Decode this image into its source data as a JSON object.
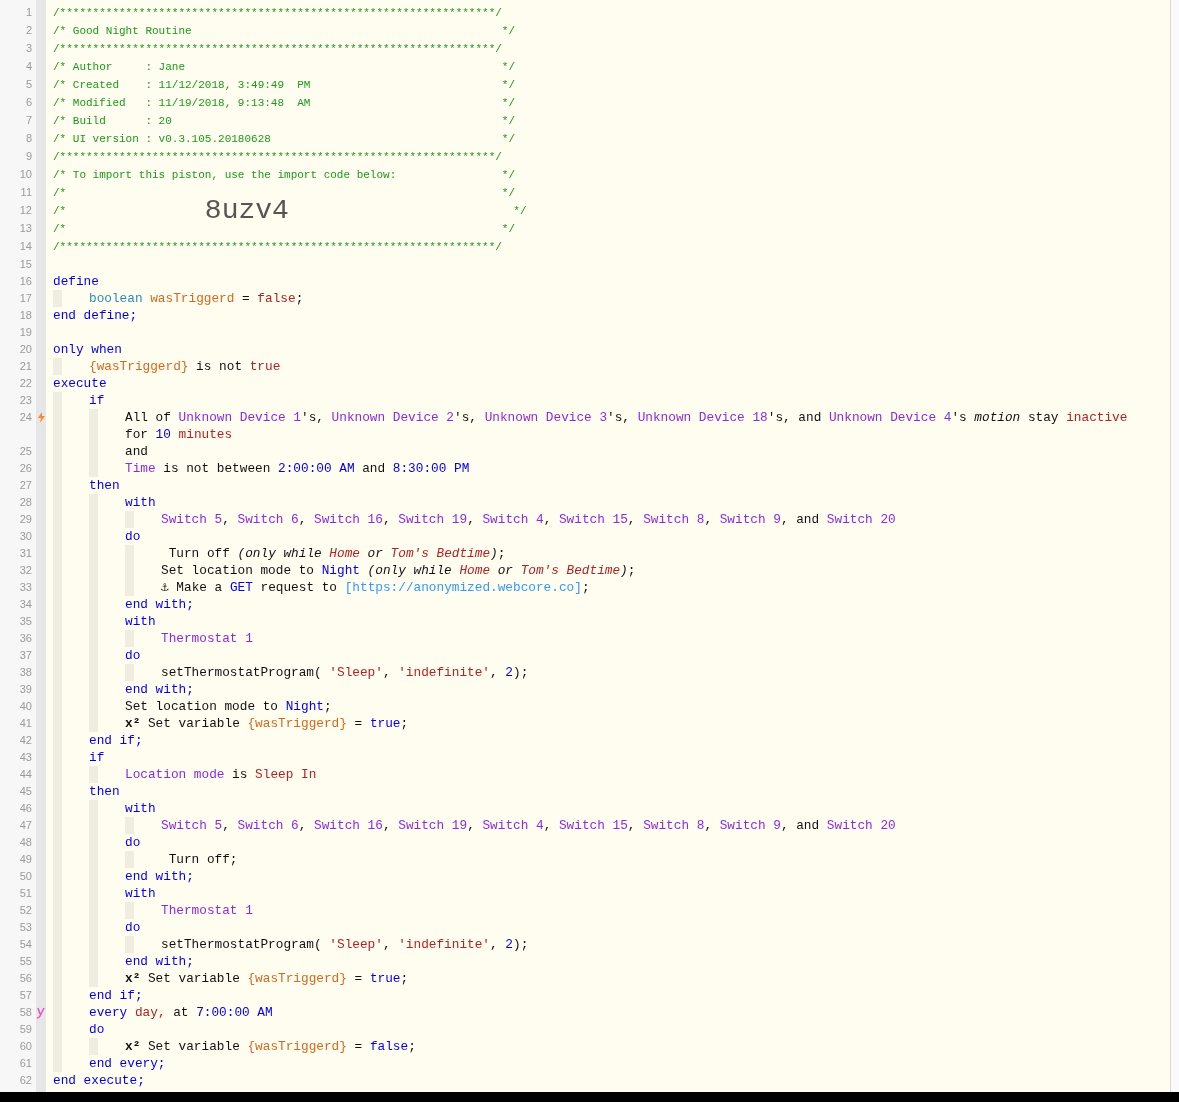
{
  "lines": [
    {
      "number": "1",
      "segments": [
        {
          "kind": "comment",
          "text": "/******************************************************************/"
        }
      ]
    },
    {
      "number": "2",
      "segments": [
        {
          "kind": "comment",
          "text": "/* Good Night Routine                                               */"
        }
      ]
    },
    {
      "number": "3",
      "segments": [
        {
          "kind": "comment",
          "text": "/******************************************************************/"
        }
      ]
    },
    {
      "number": "4",
      "segments": [
        {
          "kind": "comment",
          "text": "/* Author     : Jane                                                */"
        }
      ]
    },
    {
      "number": "5",
      "segments": [
        {
          "kind": "comment",
          "text": "/* Created    : 11/12/2018, 3:49:49  PM                             */"
        }
      ]
    },
    {
      "number": "6",
      "segments": [
        {
          "kind": "comment",
          "text": "/* Modified   : 11/19/2018, 9:13:48  AM                             */"
        }
      ]
    },
    {
      "number": "7",
      "segments": [
        {
          "kind": "comment",
          "text": "/* Build      : 20                                                  */"
        }
      ]
    },
    {
      "number": "8",
      "segments": [
        {
          "kind": "comment",
          "text": "/* UI version : v0.3.105.20180628                                   */"
        }
      ]
    },
    {
      "number": "9",
      "segments": [
        {
          "kind": "comment",
          "text": "/******************************************************************/"
        }
      ]
    },
    {
      "number": "10",
      "segments": [
        {
          "kind": "comment",
          "text": "/* To import this piston, use the import code below:                */"
        }
      ]
    },
    {
      "number": "11",
      "segments": [
        {
          "kind": "comment",
          "text": "/*                                                                  */"
        }
      ]
    },
    {
      "number": "12",
      "segments": [
        {
          "kind": "comment",
          "text": "/*                     "
        },
        {
          "kind": "import-code",
          "text": "8uzv4"
        },
        {
          "kind": "comment",
          "text": "                                  */"
        }
      ]
    },
    {
      "number": "13",
      "segments": [
        {
          "kind": "comment",
          "text": "/*                                                                  */"
        }
      ]
    },
    {
      "number": "14",
      "segments": [
        {
          "kind": "comment",
          "text": "/******************************************************************/"
        }
      ]
    },
    {
      "number": "15"
    },
    {
      "number": "16",
      "segments": [
        {
          "kind": "keyword",
          "text": "define"
        }
      ],
      "children": [
        {
          "number": "17",
          "segments": [
            {
              "kind": "type",
              "text": "boolean "
            },
            {
              "kind": "variable",
              "text": "wasTriggerd"
            },
            {
              "kind": "plain",
              "text": " = "
            },
            {
              "kind": "value",
              "text": "false"
            },
            {
              "kind": "plain",
              "text": ";"
            }
          ]
        }
      ]
    },
    {
      "number": "18",
      "segments": [
        {
          "kind": "keyword",
          "text": "end define;"
        }
      ]
    },
    {
      "number": "19"
    },
    {
      "number": "20",
      "segments": [
        {
          "kind": "keyword",
          "text": "only when"
        }
      ],
      "children": [
        {
          "number": "21",
          "segments": [
            {
              "kind": "variable",
              "text": "{wasTriggerd}"
            },
            {
              "kind": "plain",
              "text": " is not "
            },
            {
              "kind": "value",
              "text": "true"
            }
          ]
        }
      ]
    },
    {
      "number": "22",
      "segments": [
        {
          "kind": "keyword",
          "text": "execute"
        }
      ],
      "children": [
        {
          "number": "23",
          "segments": [
            {
              "kind": "keyword",
              "text": "if"
            }
          ],
          "children": [
            {
              "number": "24",
              "kind": "trigger",
              "segments": [
                {
                  "kind": "plain",
                  "text": "All of "
                },
                {
                  "kind": "device",
                  "text": "Unknown Device 1"
                },
                {
                  "kind": "plain",
                  "text": "'s, "
                },
                {
                  "kind": "device",
                  "text": "Unknown Device 2"
                },
                {
                  "kind": "plain",
                  "text": "'s, "
                },
                {
                  "kind": "device",
                  "text": "Unknown Device 3"
                },
                {
                  "kind": "plain",
                  "text": "'s, "
                },
                {
                  "kind": "device",
                  "text": "Unknown Device 18"
                },
                {
                  "kind": "plain",
                  "text": "'s, and "
                },
                {
                  "kind": "device",
                  "text": "Unknown Device 4"
                },
                {
                  "kind": "plain",
                  "text": "'s "
                },
                {
                  "kind": "italic",
                  "text": "motion"
                },
                {
                  "kind": "plain",
                  "text": " stay "
                },
                {
                  "kind": "value",
                  "text": "inactive"
                },
                {
                  "kind": "plain",
                  "text": " for "
                },
                {
                  "kind": "keyword",
                  "text": "10"
                },
                {
                  "kind": "value",
                  "text": " minutes"
                }
              ]
            },
            {
              "number": "25",
              "segments": [
                {
                  "kind": "plain",
                  "text": "and"
                }
              ]
            },
            {
              "number": "26",
              "segments": [
                {
                  "kind": "device",
                  "text": "Time"
                },
                {
                  "kind": "plain",
                  "text": " is not between "
                },
                {
                  "kind": "keyword",
                  "text": "2:00:00 AM"
                },
                {
                  "kind": "plain",
                  "text": " and "
                },
                {
                  "kind": "keyword",
                  "text": "8:30:00 PM"
                }
              ]
            }
          ]
        },
        {
          "number": "27",
          "segments": [
            {
              "kind": "keyword",
              "text": "then"
            }
          ],
          "children": [
            {
              "number": "28",
              "segments": [
                {
                  "kind": "keyword",
                  "text": "with"
                }
              ],
              "children": [
                {
                  "number": "29",
                  "segments": [
                    {
                      "kind": "device",
                      "text": "Switch 5"
                    },
                    {
                      "kind": "plain",
                      "text": ", "
                    },
                    {
                      "kind": "device",
                      "text": "Switch 6"
                    },
                    {
                      "kind": "plain",
                      "text": ", "
                    },
                    {
                      "kind": "device",
                      "text": "Switch 16"
                    },
                    {
                      "kind": "plain",
                      "text": ", "
                    },
                    {
                      "kind": "device",
                      "text": "Switch 19"
                    },
                    {
                      "kind": "plain",
                      "text": ", "
                    },
                    {
                      "kind": "device",
                      "text": "Switch 4"
                    },
                    {
                      "kind": "plain",
                      "text": ", "
                    },
                    {
                      "kind": "device",
                      "text": "Switch 15"
                    },
                    {
                      "kind": "plain",
                      "text": ", "
                    },
                    {
                      "kind": "device",
                      "text": "Switch 8"
                    },
                    {
                      "kind": "plain",
                      "text": ", "
                    },
                    {
                      "kind": "device",
                      "text": "Switch 9"
                    },
                    {
                      "kind": "plain",
                      "text": ", and "
                    },
                    {
                      "kind": "device",
                      "text": "Switch 20"
                    }
                  ]
                }
              ]
            },
            {
              "number": "30",
              "segments": [
                {
                  "kind": "keyword",
                  "text": "do"
                }
              ],
              "children": [
                {
                  "number": "31",
                  "segments": [
                    {
                      "kind": "plain",
                      "text": " Turn off "
                    },
                    {
                      "kind": "italic",
                      "text": "(only while "
                    },
                    {
                      "kind": "italic-value",
                      "text": "Home"
                    },
                    {
                      "kind": "italic",
                      "text": " or "
                    },
                    {
                      "kind": "italic-value",
                      "text": "Tom's Bedtime"
                    },
                    {
                      "kind": "italic",
                      "text": ")"
                    },
                    {
                      "kind": "plain",
                      "text": ";"
                    }
                  ]
                },
                {
                  "number": "32",
                  "segments": [
                    {
                      "kind": "plain",
                      "text": "Set location mode to "
                    },
                    {
                      "kind": "keyword",
                      "text": "Night"
                    },
                    {
                      "kind": "italic",
                      "text": " (only while "
                    },
                    {
                      "kind": "italic-value",
                      "text": "Home"
                    },
                    {
                      "kind": "italic",
                      "text": " or "
                    },
                    {
                      "kind": "italic-value",
                      "text": "Tom's Bedtime"
                    },
                    {
                      "kind": "italic",
                      "text": ")"
                    },
                    {
                      "kind": "plain",
                      "text": ";"
                    }
                  ]
                },
                {
                  "number": "33",
                  "segments": [
                    {
                      "kind": "plain",
                      "text": "⚓ Make a "
                    },
                    {
                      "kind": "keyword",
                      "text": "GET"
                    },
                    {
                      "kind": "plain",
                      "text": " request to "
                    },
                    {
                      "kind": "url",
                      "text": "[https://anonymized.webcore.co]"
                    },
                    {
                      "kind": "plain",
                      "text": ";"
                    }
                  ]
                }
              ]
            },
            {
              "number": "34",
              "segments": [
                {
                  "kind": "keyword",
                  "text": "end with;"
                }
              ]
            },
            {
              "number": "35",
              "segments": [
                {
                  "kind": "keyword",
                  "text": "with"
                }
              ],
              "children": [
                {
                  "number": "36",
                  "segments": [
                    {
                      "kind": "device",
                      "text": "Thermostat 1"
                    }
                  ]
                }
              ]
            },
            {
              "number": "37",
              "segments": [
                {
                  "kind": "keyword",
                  "text": "do"
                }
              ],
              "children": [
                {
                  "number": "38",
                  "segments": [
                    {
                      "kind": "plain",
                      "text": "setThermostatProgram( "
                    },
                    {
                      "kind": "value",
                      "text": "'Sleep'"
                    },
                    {
                      "kind": "plain",
                      "text": ", "
                    },
                    {
                      "kind": "value",
                      "text": "'indefinite'"
                    },
                    {
                      "kind": "plain",
                      "text": ", "
                    },
                    {
                      "kind": "keyword",
                      "text": "2"
                    },
                    {
                      "kind": "plain",
                      "text": ");"
                    }
                  ]
                }
              ]
            },
            {
              "number": "39",
              "segments": [
                {
                  "kind": "keyword",
                  "text": "end with;"
                }
              ]
            },
            {
              "number": "40",
              "segments": [
                {
                  "kind": "plain",
                  "text": "Set location mode to "
                },
                {
                  "kind": "keyword",
                  "text": "Night"
                },
                {
                  "kind": "plain",
                  "text": ";"
                }
              ]
            },
            {
              "number": "41",
              "segments": [
                {
                  "kind": "bold",
                  "text": "x²"
                },
                {
                  "kind": "plain",
                  "text": " Set variable "
                },
                {
                  "kind": "variable",
                  "text": "{wasTriggerd}"
                },
                {
                  "kind": "plain",
                  "text": " = "
                },
                {
                  "kind": "keyword",
                  "text": "true"
                },
                {
                  "kind": "plain",
                  "text": ";"
                }
              ]
            }
          ]
        },
        {
          "number": "42",
          "segments": [
            {
              "kind": "keyword",
              "text": "end if;"
            }
          ]
        },
        {
          "number": "43",
          "segments": [
            {
              "kind": "keyword",
              "text": "if"
            }
          ],
          "children": [
            {
              "number": "44",
              "segments": [
                {
                  "kind": "device",
                  "text": "Location mode"
                },
                {
                  "kind": "plain",
                  "text": " is "
                },
                {
                  "kind": "value",
                  "text": "Sleep In"
                }
              ]
            }
          ]
        },
        {
          "number": "45",
          "segments": [
            {
              "kind": "keyword",
              "text": "then"
            }
          ],
          "children": [
            {
              "number": "46",
              "segments": [
                {
                  "kind": "keyword",
                  "text": "with"
                }
              ],
              "children": [
                {
                  "number": "47",
                  "segments": [
                    {
                      "kind": "device",
                      "text": "Switch 5"
                    },
                    {
                      "kind": "plain",
                      "text": ", "
                    },
                    {
                      "kind": "device",
                      "text": "Switch 6"
                    },
                    {
                      "kind": "plain",
                      "text": ", "
                    },
                    {
                      "kind": "device",
                      "text": "Switch 16"
                    },
                    {
                      "kind": "plain",
                      "text": ", "
                    },
                    {
                      "kind": "device",
                      "text": "Switch 19"
                    },
                    {
                      "kind": "plain",
                      "text": ", "
                    },
                    {
                      "kind": "device",
                      "text": "Switch 4"
                    },
                    {
                      "kind": "plain",
                      "text": ", "
                    },
                    {
                      "kind": "device",
                      "text": "Switch 15"
                    },
                    {
                      "kind": "plain",
                      "text": ", "
                    },
                    {
                      "kind": "device",
                      "text": "Switch 8"
                    },
                    {
                      "kind": "plain",
                      "text": ", "
                    },
                    {
                      "kind": "device",
                      "text": "Switch 9"
                    },
                    {
                      "kind": "plain",
                      "text": ", and "
                    },
                    {
                      "kind": "device",
                      "text": "Switch 20"
                    }
                  ]
                }
              ]
            },
            {
              "number": "48",
              "segments": [
                {
                  "kind": "keyword",
                  "text": "do"
                }
              ],
              "children": [
                {
                  "number": "49",
                  "segments": [
                    {
                      "kind": "plain",
                      "text": " Turn off;"
                    }
                  ]
                }
              ]
            },
            {
              "number": "50",
              "segments": [
                {
                  "kind": "keyword",
                  "text": "end with;"
                }
              ]
            },
            {
              "number": "51",
              "segments": [
                {
                  "kind": "keyword",
                  "text": "with"
                }
              ],
              "children": [
                {
                  "number": "52",
                  "segments": [
                    {
                      "kind": "device",
                      "text": "Thermostat 1"
                    }
                  ]
                }
              ]
            },
            {
              "number": "53",
              "segments": [
                {
                  "kind": "keyword",
                  "text": "do"
                }
              ],
              "children": [
                {
                  "number": "54",
                  "segments": [
                    {
                      "kind": "plain",
                      "text": "setThermostatProgram( "
                    },
                    {
                      "kind": "value",
                      "text": "'Sleep'"
                    },
                    {
                      "kind": "plain",
                      "text": ", "
                    },
                    {
                      "kind": "value",
                      "text": "'indefinite'"
                    },
                    {
                      "kind": "plain",
                      "text": ", "
                    },
                    {
                      "kind": "keyword",
                      "text": "2"
                    },
                    {
                      "kind": "plain",
                      "text": ");"
                    }
                  ]
                }
              ]
            },
            {
              "number": "55",
              "segments": [
                {
                  "kind": "keyword",
                  "text": "end with;"
                }
              ]
            },
            {
              "number": "56",
              "segments": [
                {
                  "kind": "bold",
                  "text": "x²"
                },
                {
                  "kind": "plain",
                  "text": " Set variable "
                },
                {
                  "kind": "variable",
                  "text": "{wasTriggerd}"
                },
                {
                  "kind": "plain",
                  "text": " = "
                },
                {
                  "kind": "keyword",
                  "text": "true"
                },
                {
                  "kind": "plain",
                  "text": ";"
                }
              ]
            }
          ]
        },
        {
          "number": "57",
          "segments": [
            {
              "kind": "keyword",
              "text": "end if;"
            }
          ]
        },
        {
          "number": "58",
          "kind": "timer",
          "segments": [
            {
              "kind": "keyword",
              "text": "every "
            },
            {
              "kind": "value",
              "text": "day,"
            },
            {
              "kind": "plain",
              "text": " at "
            },
            {
              "kind": "keyword",
              "text": "7:00:00 AM"
            }
          ]
        },
        {
          "number": "59",
          "segments": [
            {
              "kind": "keyword",
              "text": "do"
            }
          ],
          "children": [
            {
              "number": "60",
              "segments": [
                {
                  "kind": "bold",
                  "text": "x²"
                },
                {
                  "kind": "plain",
                  "text": " Set variable "
                },
                {
                  "kind": "variable",
                  "text": "{wasTriggerd}"
                },
                {
                  "kind": "plain",
                  "text": " = "
                },
                {
                  "kind": "keyword",
                  "text": "false"
                },
                {
                  "kind": "plain",
                  "text": ";"
                }
              ]
            }
          ]
        },
        {
          "number": "61",
          "segments": [
            {
              "kind": "keyword",
              "text": "end every;"
            }
          ]
        }
      ]
    },
    {
      "number": "62",
      "segments": [
        {
          "kind": "keyword",
          "text": "end execute;"
        }
      ]
    }
  ]
}
